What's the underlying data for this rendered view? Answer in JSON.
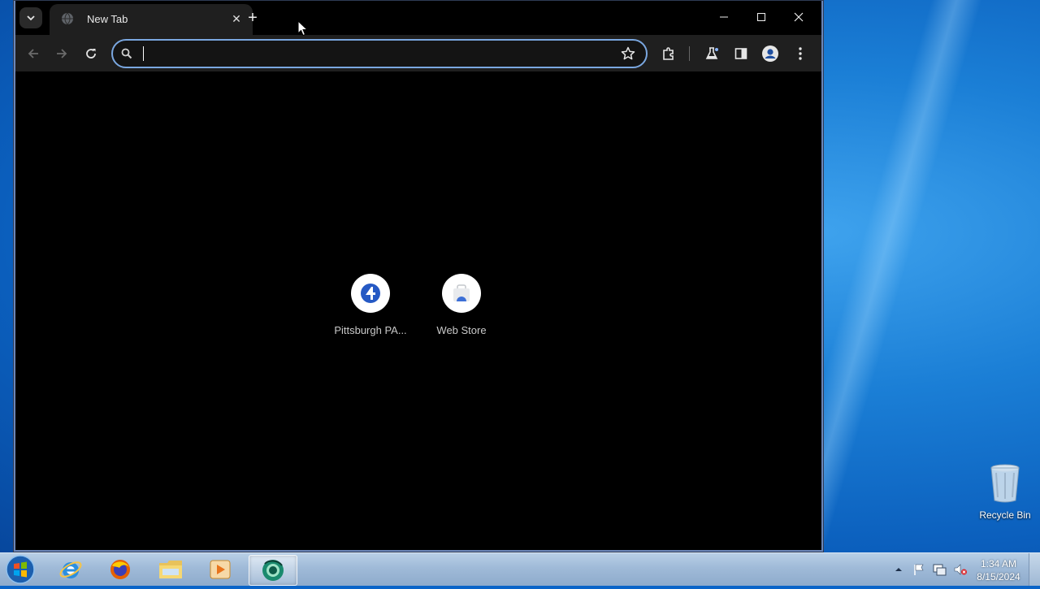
{
  "browser": {
    "tab": {
      "title": "New Tab",
      "close_symbol": "✕"
    },
    "new_tab_symbol": "+",
    "omnibox": {
      "value": "",
      "placeholder": ""
    }
  },
  "shortcuts": [
    {
      "label": "Pittsburgh PA...",
      "icon": "pittsburgh-site-icon"
    },
    {
      "label": "Web Store",
      "icon": "web-store-icon"
    }
  ],
  "desktop": {
    "recycle_bin_label": "Recycle Bin"
  },
  "taskbar": {
    "items": [
      "internet-explorer-icon",
      "firefox-icon",
      "file-explorer-icon",
      "media-player-icon",
      "chrome-canary-icon"
    ],
    "clock": {
      "time": "1:34 AM",
      "date": "8/15/2024"
    }
  },
  "colors": {
    "desktop_blue": "#1b7fd6",
    "toolbar": "#1f1f1f",
    "omnibox_focus": "#7aa7e0"
  }
}
